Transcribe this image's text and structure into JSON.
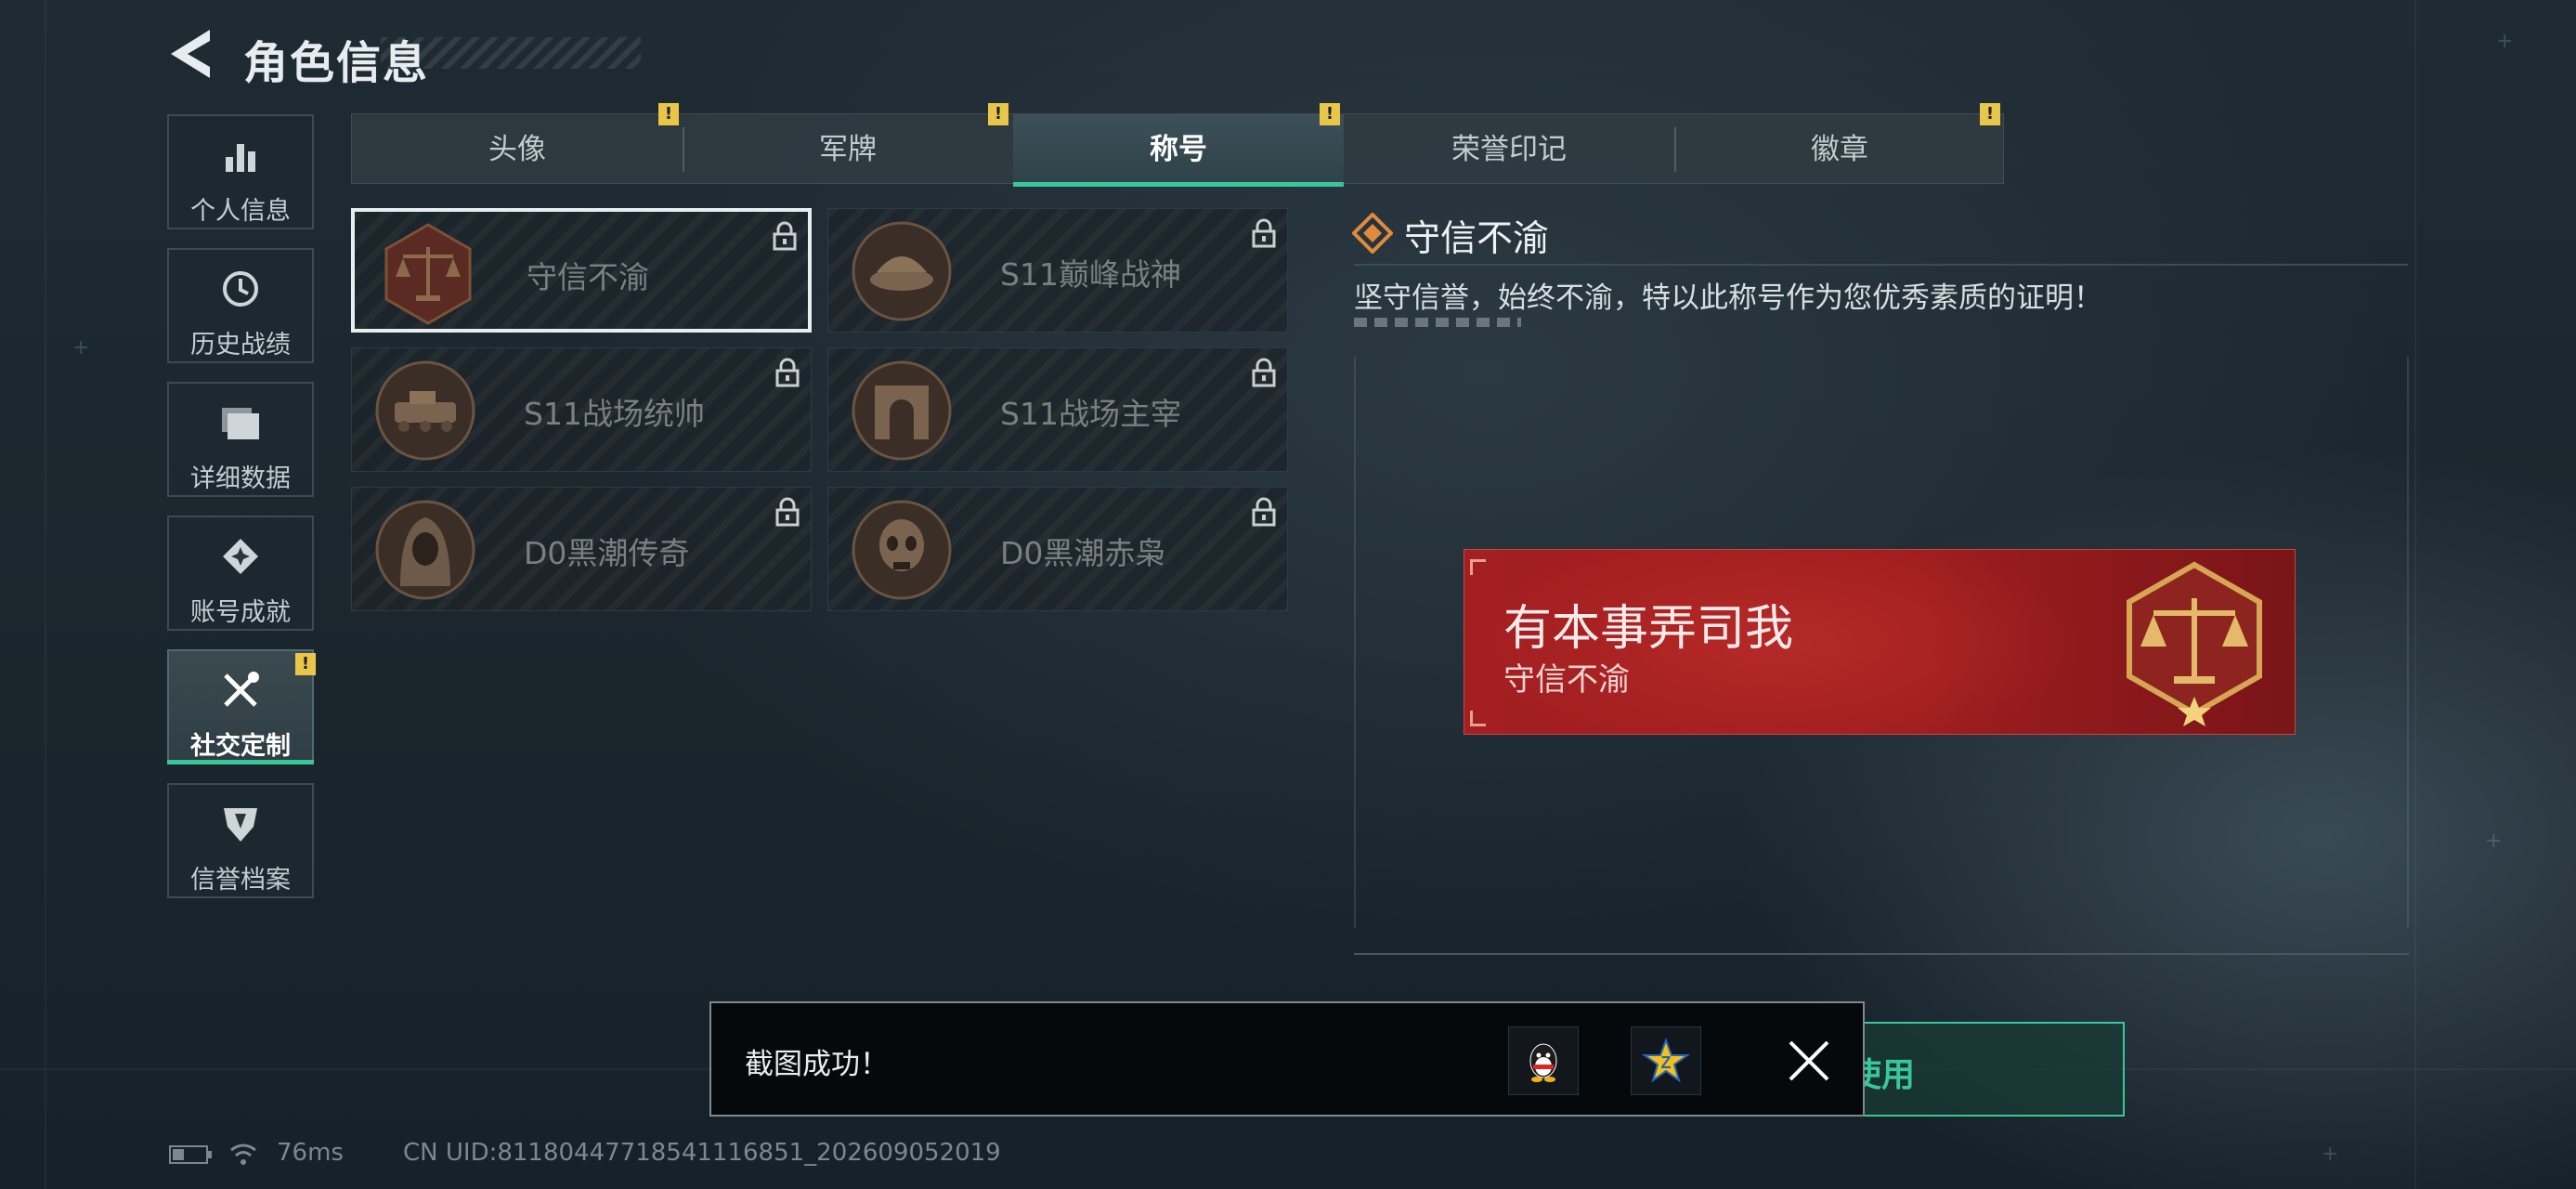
{
  "header": {
    "title": "角色信息",
    "back_icon": "back-arrow-icon"
  },
  "nav": {
    "items": [
      {
        "label": "个人信息",
        "icon": "bar-chart-icon",
        "active": false
      },
      {
        "label": "历史战绩",
        "icon": "clock-icon",
        "active": false
      },
      {
        "label": "详细数据",
        "icon": "folder-icon",
        "active": false
      },
      {
        "label": "账号成就",
        "icon": "achievement-star-icon",
        "active": false
      },
      {
        "label": "社交定制",
        "icon": "tools-icon",
        "active": true,
        "alert": "!"
      },
      {
        "label": "信誉档案",
        "icon": "shield-icon",
        "active": false
      }
    ]
  },
  "tabs": [
    {
      "label": "头像",
      "alert": "!"
    },
    {
      "label": "军牌",
      "alert": "!"
    },
    {
      "label": "称号",
      "alert": "!",
      "active": true
    },
    {
      "label": "荣誉印记"
    },
    {
      "label": "徽章",
      "alert": "!"
    }
  ],
  "titles": [
    {
      "name": "守信不渝",
      "emblem": "scales-emblem-icon",
      "locked": true,
      "selected": true
    },
    {
      "name": "S11巅峰战神",
      "emblem": "tank-emblem-icon",
      "locked": true
    },
    {
      "name": "S11战场统帅",
      "emblem": "armored-vehicle-emblem-icon",
      "locked": true
    },
    {
      "name": "S11战场主宰",
      "emblem": "arch-emblem-icon",
      "locked": true
    },
    {
      "name": "D0黑潮传奇",
      "emblem": "hooded-figure-emblem-icon",
      "locked": true
    },
    {
      "name": "D0黑潮赤枭",
      "emblem": "skull-mask-emblem-icon",
      "locked": true
    }
  ],
  "detail": {
    "title": "守信不渝",
    "description": "坚守信誉，始终不渝，特以此称号作为您优秀素质的证明！"
  },
  "preview": {
    "player_name": "有本事弄司我",
    "title_name": "守信不渝",
    "color": "#a31f21"
  },
  "use_button": {
    "label": "使用"
  },
  "toast": {
    "message": "截图成功！",
    "buttons": [
      "qq-penguin-icon",
      "qzone-star-icon"
    ],
    "close_icon": "close-icon"
  },
  "status": {
    "ping": "76ms",
    "uid": "CN UID:81180447718541116851_202609052019"
  },
  "colors": {
    "accent": "#39c79a",
    "warning": "#e8c64a",
    "banner_red": "#a31f21"
  }
}
